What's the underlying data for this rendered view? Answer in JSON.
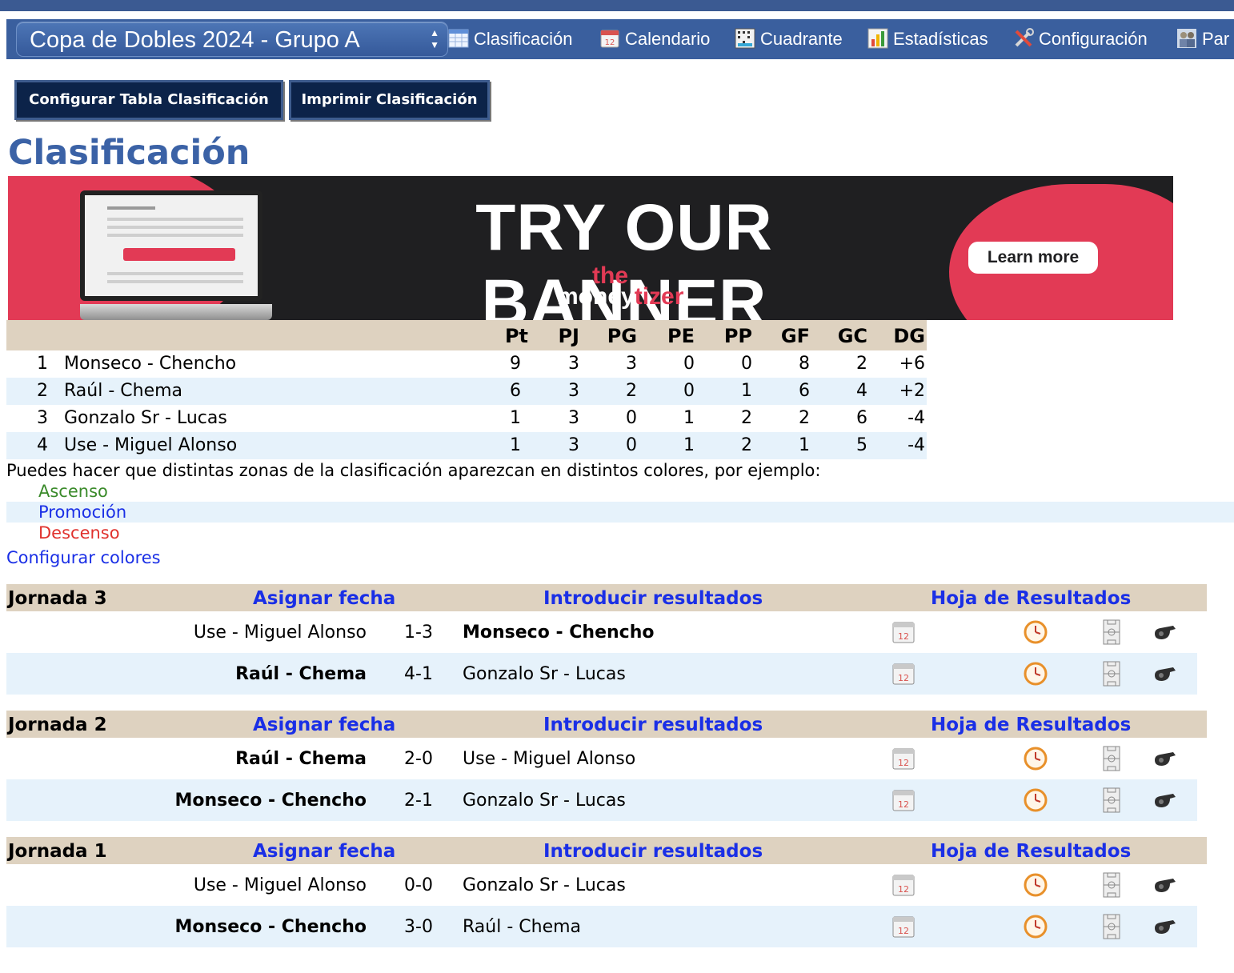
{
  "competition_select": {
    "value": "Copa de Dobles 2024 - Grupo A"
  },
  "nav": [
    {
      "label": "Clasificación",
      "icon": "table-icon"
    },
    {
      "label": "Calendario",
      "icon": "calendar-icon"
    },
    {
      "label": "Cuadrante",
      "icon": "grid-icon"
    },
    {
      "label": "Estadísticas",
      "icon": "bar-chart-icon"
    },
    {
      "label": "Configuración",
      "icon": "tools-icon"
    },
    {
      "label": "Par",
      "icon": "people-icon"
    }
  ],
  "buttons": {
    "configure_table": "Configurar Tabla Clasificación",
    "print": "Imprimir Clasificación"
  },
  "page_title": "Clasificación",
  "banner": {
    "headline": "TRY OUR BANNER",
    "brand_the": "the",
    "brand_money": "money",
    "brand_tizer": "tizer",
    "cta": "Learn more"
  },
  "standings": {
    "columns": [
      "Pt",
      "PJ",
      "PG",
      "PE",
      "PP",
      "GF",
      "GC",
      "DG"
    ],
    "rows": [
      {
        "pos": "1",
        "name": "Monseco - Chencho",
        "values": [
          "9",
          "3",
          "3",
          "0",
          "0",
          "8",
          "2",
          "+6"
        ]
      },
      {
        "pos": "2",
        "name": "Raúl - Chema",
        "values": [
          "6",
          "3",
          "2",
          "0",
          "1",
          "6",
          "4",
          "+2"
        ]
      },
      {
        "pos": "3",
        "name": "Gonzalo Sr - Lucas",
        "values": [
          "1",
          "3",
          "0",
          "1",
          "2",
          "2",
          "6",
          "-4"
        ]
      },
      {
        "pos": "4",
        "name": "Use - Miguel Alonso",
        "values": [
          "1",
          "3",
          "0",
          "1",
          "2",
          "1",
          "5",
          "-4"
        ]
      }
    ]
  },
  "zones": {
    "hint": "Puedes hacer que distintas zonas de la clasificación aparezcan en distintos colores, por ejemplo:",
    "items": [
      "Ascenso",
      "Promoción",
      "Descenso"
    ],
    "colors": [
      "#3a8a2a",
      "#1a2fe6",
      "#e0322e"
    ],
    "configure_link": "Configurar colores"
  },
  "jornadas": [
    {
      "title": "Jornada 3",
      "assign_date": "Asignar fecha",
      "enter_results": "Introducir resultados",
      "results_sheet": "Hoja de Resultados",
      "matches": [
        {
          "home": "Use - Miguel Alonso",
          "score": "1-3",
          "away": "Monseco - Chencho",
          "winner": "away"
        },
        {
          "home": "Raúl - Chema",
          "score": "4-1",
          "away": "Gonzalo Sr - Lucas",
          "winner": "home"
        }
      ]
    },
    {
      "title": "Jornada 2",
      "assign_date": "Asignar fecha",
      "enter_results": "Introducir resultados",
      "results_sheet": "Hoja de Resultados",
      "matches": [
        {
          "home": "Raúl - Chema",
          "score": "2-0",
          "away": "Use - Miguel Alonso",
          "winner": "home"
        },
        {
          "home": "Monseco - Chencho",
          "score": "2-1",
          "away": "Gonzalo Sr - Lucas",
          "winner": "home"
        }
      ]
    },
    {
      "title": "Jornada 1",
      "assign_date": "Asignar fecha",
      "enter_results": "Introducir resultados",
      "results_sheet": "Hoja de Resultados",
      "matches": [
        {
          "home": "Use - Miguel Alonso",
          "score": "0-0",
          "away": "Gonzalo Sr - Lucas",
          "winner": "none"
        },
        {
          "home": "Monseco - Chencho",
          "score": "3-0",
          "away": "Raúl - Chema",
          "winner": "home"
        }
      ]
    }
  ],
  "match_action_icons": [
    "calendar-icon",
    "clock-icon",
    "field-lineup-icon",
    "whistle-icon"
  ],
  "colors": {
    "nav_bg": "#3a5f9e",
    "button_bg": "#0c2349",
    "title": "#3b62a6",
    "header_bg": "#ded2c0",
    "row_alt": "#e6f2fb",
    "link": "#1a2fe6"
  }
}
